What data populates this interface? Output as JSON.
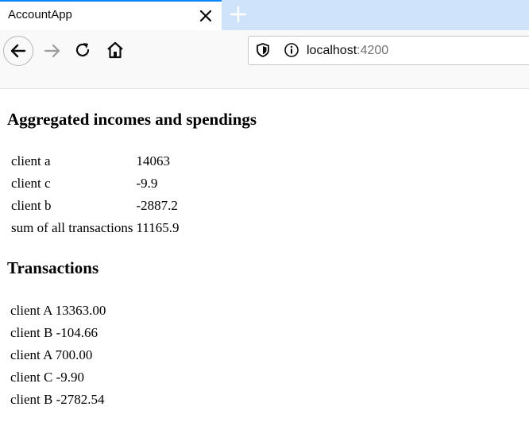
{
  "browser": {
    "tab_title": "AccountApp",
    "url_host": "localhost",
    "url_port": ":4200"
  },
  "page": {
    "aggregated_heading": "Aggregated incomes and spendings",
    "aggregated_rows": [
      {
        "label": "client a",
        "value": "14063"
      },
      {
        "label": "client c",
        "value": "-9.9"
      },
      {
        "label": "client b",
        "value": "-2887.2"
      },
      {
        "label": "sum of all transactions",
        "value": "11165.9"
      }
    ],
    "transactions_heading": "Transactions",
    "transactions": [
      "client A 13363.00",
      "client B -104.66",
      "client A 700.00",
      "client C -9.90",
      "client B -2782.54"
    ]
  },
  "icons": {
    "close": "close-icon",
    "new_tab": "plus-icon",
    "back": "back-arrow-icon",
    "forward": "forward-arrow-icon",
    "reload": "reload-icon",
    "home": "home-icon",
    "tracking": "shield-icon",
    "site_info": "info-icon"
  },
  "colors": {
    "tab_accent": "#0a84ff",
    "tabstrip_bg": "#cfe3fb"
  }
}
